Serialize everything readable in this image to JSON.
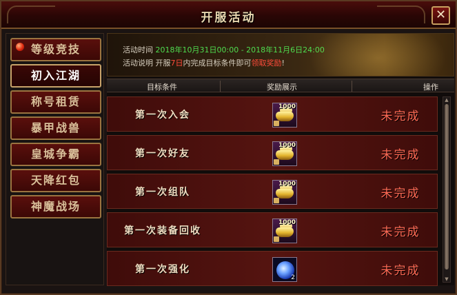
{
  "window": {
    "title": "开服活动",
    "close_label": "✕"
  },
  "sidebar": {
    "items": [
      {
        "label": "等级竞技",
        "active": false,
        "has_dot": true
      },
      {
        "label": "初入江湖",
        "active": true,
        "has_dot": false
      },
      {
        "label": "称号租赁",
        "active": false,
        "has_dot": false
      },
      {
        "label": "暴甲战兽",
        "active": false,
        "has_dot": false
      },
      {
        "label": "皇城争霸",
        "active": false,
        "has_dot": false
      },
      {
        "label": "天降红包",
        "active": false,
        "has_dot": false
      },
      {
        "label": "神魔战场",
        "active": false,
        "has_dot": false
      }
    ]
  },
  "banner": {
    "time_label": "活动时间",
    "time_start": "2018年10月31日00:00",
    "time_sep": " - ",
    "time_end": "2018年11月6日24:00",
    "desc_label": "活动说明",
    "desc_prefix": "开服",
    "desc_highlight1": "7日",
    "desc_middle": "内完成目标条件即可",
    "desc_highlight2": "领取奖励",
    "desc_suffix": "!"
  },
  "table": {
    "headers": {
      "goal": "目标条件",
      "reward": "奖励展示",
      "action": "操作"
    },
    "rows": [
      {
        "name": "第一次入会",
        "reward_type": "gold",
        "reward_amount": "1000",
        "status": "未完成"
      },
      {
        "name": "第一次好友",
        "reward_type": "gold",
        "reward_amount": "1000",
        "status": "未完成"
      },
      {
        "name": "第一次组队",
        "reward_type": "gold",
        "reward_amount": "1000",
        "status": "未完成"
      },
      {
        "name": "第一次装备回收",
        "reward_type": "gold",
        "reward_amount": "1000",
        "status": "未完成"
      },
      {
        "name": "第一次强化",
        "reward_type": "orb",
        "reward_count": "2",
        "status": "未完成"
      }
    ]
  },
  "colors": {
    "accent_gold": "#c8a36a",
    "status_red": "#ff6a55",
    "time_green": "#4fdc4f",
    "highlight_red": "#ff4b3a"
  }
}
